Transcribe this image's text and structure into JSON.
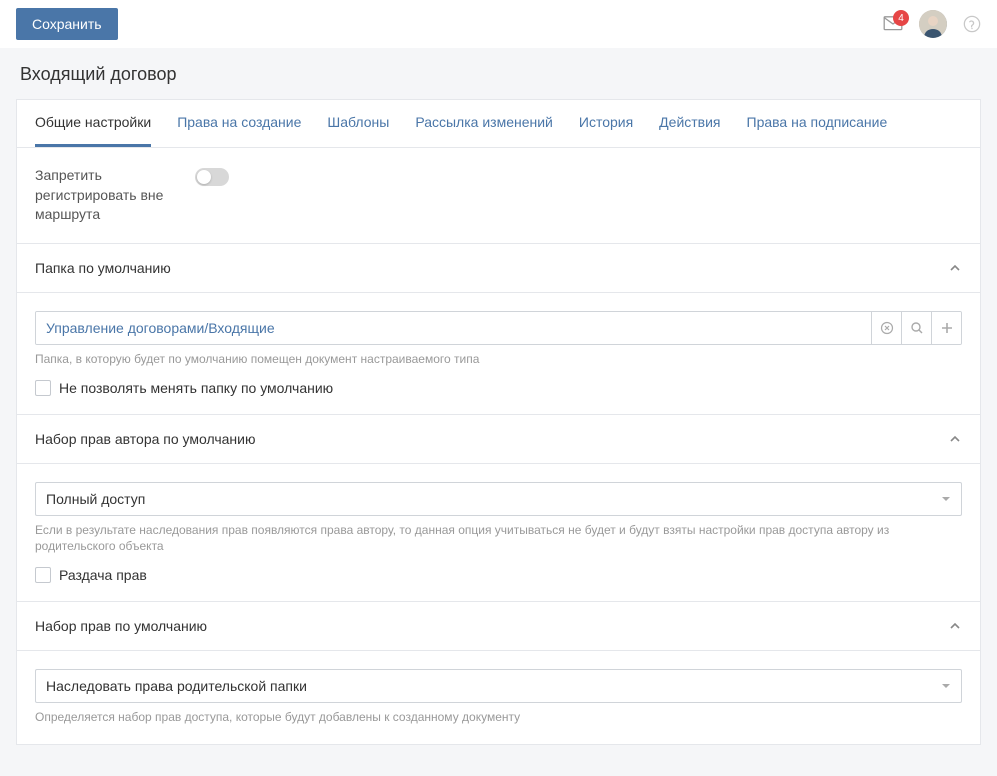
{
  "topbar": {
    "save_label": "Сохранить",
    "notification_count": "4"
  },
  "page_title": "Входящий договор",
  "tabs": [
    {
      "label": "Общие настройки",
      "active": true
    },
    {
      "label": "Права на создание"
    },
    {
      "label": "Шаблоны"
    },
    {
      "label": "Рассылка изменений"
    },
    {
      "label": "История"
    },
    {
      "label": "Действия"
    },
    {
      "label": "Права на подписание"
    }
  ],
  "forbid_register": {
    "label": "Запретить регистрировать вне маршрута",
    "value": false
  },
  "default_folder": {
    "title": "Папка по умолчанию",
    "value": "Управление договорами/Входящие",
    "hint": "Папка, в которую будет по умолчанию помещен документ настраиваемого типа",
    "lock_label": "Не позволять менять папку по умолчанию"
  },
  "author_rights": {
    "title": "Набор прав автора по умолчанию",
    "value": "Полный доступ",
    "hint": "Если в результате наследования прав появляются права автору, то данная опция учитываться не будет и будут взяты настройки прав доступа автору из родительского объекта",
    "grant_label": "Раздача прав"
  },
  "default_rights": {
    "title": "Набор прав по умолчанию",
    "value": "Наследовать права родительской папки",
    "hint": "Определяется набор прав доступа, которые будут добавлены к созданному документу"
  }
}
